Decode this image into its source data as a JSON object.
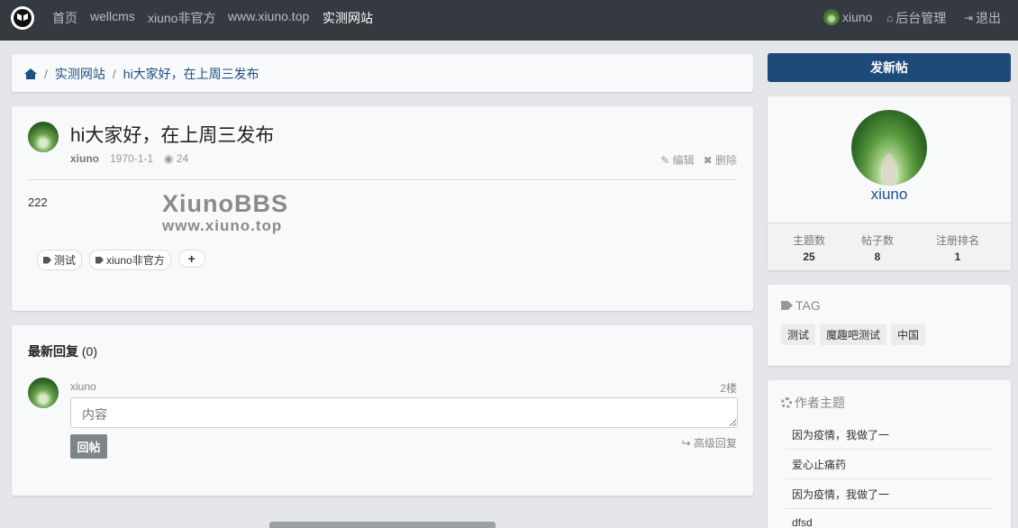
{
  "nav": {
    "links": [
      "首页",
      "wellcms",
      "xiuno非官方",
      "www.xiuno.top",
      "实测网站"
    ],
    "user": "xiuno",
    "admin": "后台管理",
    "logout": "退出"
  },
  "breadcrumb": {
    "items": [
      "实测网站",
      "hi大家好，在上周三发布"
    ]
  },
  "post": {
    "title": "hi大家好，在上周三发布",
    "author": "xiuno",
    "date": "1970-1-1",
    "views": "24",
    "edit_label": "编辑",
    "delete_label": "删除",
    "body": "222",
    "watermark_line1": "XiunoBBS",
    "watermark_line2": "www.xiuno.top",
    "tags": [
      "测试",
      "xiuno非官方"
    ],
    "add_tag": "+"
  },
  "replies": {
    "title": "最新回复",
    "count": "(0)",
    "user": "xiuno",
    "floor": "2楼",
    "placeholder": "内容",
    "submit_label": "回帖",
    "advanced_label": "高级回复"
  },
  "sidebar": {
    "new_post_label": "发新帖",
    "profile_name": "xiuno",
    "stats": [
      {
        "label": "主题数",
        "value": "25"
      },
      {
        "label": "帖子数",
        "value": "8"
      },
      {
        "label": "注册排名",
        "value": "1"
      }
    ],
    "tag_title": "TAG",
    "tags": [
      "测试",
      "魔趣吧测试",
      "中国"
    ],
    "threads_title": "作者主题",
    "threads": [
      "因为疫情，我做了一",
      "爱心止痛药",
      "因为疫情，我做了一",
      "dfsd"
    ]
  },
  "colors": {
    "nav_bg": "#343a40",
    "accent": "#1e4a7a",
    "link": "#1c4f84",
    "page_bg": "#e4e6e9"
  }
}
